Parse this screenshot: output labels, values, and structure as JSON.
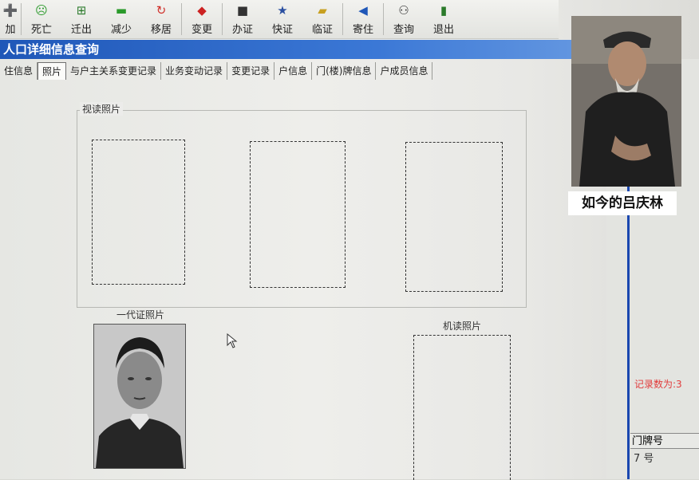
{
  "toolbar": {
    "buttons": [
      {
        "label": "加",
        "icon": "add-icon"
      },
      {
        "label": "死亡",
        "icon": "sad-face-icon"
      },
      {
        "label": "迁出",
        "icon": "move-out-icon"
      },
      {
        "label": "减少",
        "icon": "minus-icon"
      },
      {
        "label": "移居",
        "icon": "relocate-icon"
      },
      {
        "label": "变更",
        "icon": "change-icon"
      },
      {
        "label": "办证",
        "icon": "certificate-icon"
      },
      {
        "label": "快证",
        "icon": "runner-icon"
      },
      {
        "label": "临证",
        "icon": "temp-cert-icon"
      },
      {
        "label": "寄住",
        "icon": "lodging-icon"
      },
      {
        "label": "查询",
        "icon": "binoculars-icon"
      },
      {
        "label": "退出",
        "icon": "exit-icon"
      }
    ]
  },
  "window": {
    "title": "人口详细信息查询"
  },
  "tabs": [
    {
      "label": "住信息"
    },
    {
      "label": "照片",
      "active": true
    },
    {
      "label": "与户主关系变更记录"
    },
    {
      "label": "业务变动记录"
    },
    {
      "label": "变更记录"
    },
    {
      "label": "户信息"
    },
    {
      "label": "门(楼)牌信息"
    },
    {
      "label": "户成员信息"
    }
  ],
  "photo_section": {
    "group_title": "视读照片",
    "id_photo_title": "一代证照片",
    "machine_photo_title": "机读照片"
  },
  "right_panel": {
    "records_label": "记录数为:3",
    "table_header": "门牌号",
    "table_value": "7 号"
  },
  "inset": {
    "caption": "如今的吕庆林"
  }
}
